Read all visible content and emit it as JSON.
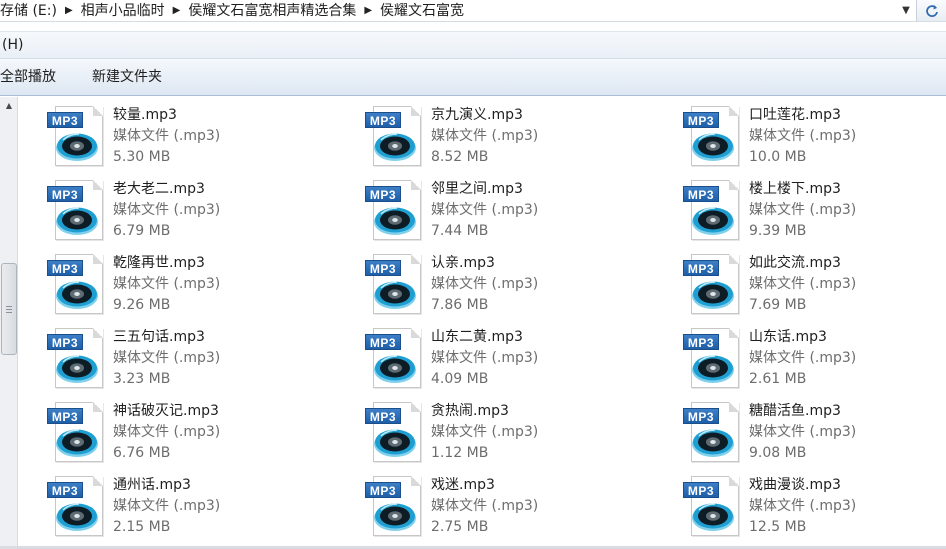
{
  "address": {
    "crumbs": [
      "存储 (E:)",
      "相声小品临时",
      "侯耀文石富宽相声精选合集",
      "侯耀文石富宽"
    ],
    "separator": "▶",
    "dropdown": "▼"
  },
  "menu": {
    "items": [
      "(H)"
    ]
  },
  "toolbar": {
    "play_all": "全部播放",
    "new_folder": "新建文件夹"
  },
  "colors": {
    "accent": "#1e5fa8",
    "secondary_text": "#6d6d6d"
  },
  "icon_badge": "MP3",
  "files": [
    {
      "name": "较量.mp3",
      "type": "媒体文件 (.mp3)",
      "size": "5.30 MB"
    },
    {
      "name": "京九演义.mp3",
      "type": "媒体文件 (.mp3)",
      "size": "8.52 MB"
    },
    {
      "name": "口吐莲花.mp3",
      "type": "媒体文件 (.mp3)",
      "size": "10.0 MB"
    },
    {
      "name": "老大老二.mp3",
      "type": "媒体文件 (.mp3)",
      "size": "6.79 MB"
    },
    {
      "name": "邻里之间.mp3",
      "type": "媒体文件 (.mp3)",
      "size": "7.44 MB"
    },
    {
      "name": "楼上楼下.mp3",
      "type": "媒体文件 (.mp3)",
      "size": "9.39 MB"
    },
    {
      "name": "乾隆再世.mp3",
      "type": "媒体文件 (.mp3)",
      "size": "9.26 MB"
    },
    {
      "name": "认亲.mp3",
      "type": "媒体文件 (.mp3)",
      "size": "7.86 MB"
    },
    {
      "name": "如此交流.mp3",
      "type": "媒体文件 (.mp3)",
      "size": "7.69 MB"
    },
    {
      "name": "三五句话.mp3",
      "type": "媒体文件 (.mp3)",
      "size": "3.23 MB"
    },
    {
      "name": "山东二黄.mp3",
      "type": "媒体文件 (.mp3)",
      "size": "4.09 MB"
    },
    {
      "name": "山东话.mp3",
      "type": "媒体文件 (.mp3)",
      "size": "2.61 MB"
    },
    {
      "name": "神话破灭记.mp3",
      "type": "媒体文件 (.mp3)",
      "size": "6.76 MB"
    },
    {
      "name": "贪热闹.mp3",
      "type": "媒体文件 (.mp3)",
      "size": "1.12 MB"
    },
    {
      "name": "糖醋活鱼.mp3",
      "type": "媒体文件 (.mp3)",
      "size": "9.08 MB"
    },
    {
      "name": "通州话.mp3",
      "type": "媒体文件 (.mp3)",
      "size": "2.15 MB"
    },
    {
      "name": "戏迷.mp3",
      "type": "媒体文件 (.mp3)",
      "size": "2.75 MB"
    },
    {
      "name": "戏曲漫谈.mp3",
      "type": "媒体文件 (.mp3)",
      "size": "12.5 MB"
    }
  ]
}
